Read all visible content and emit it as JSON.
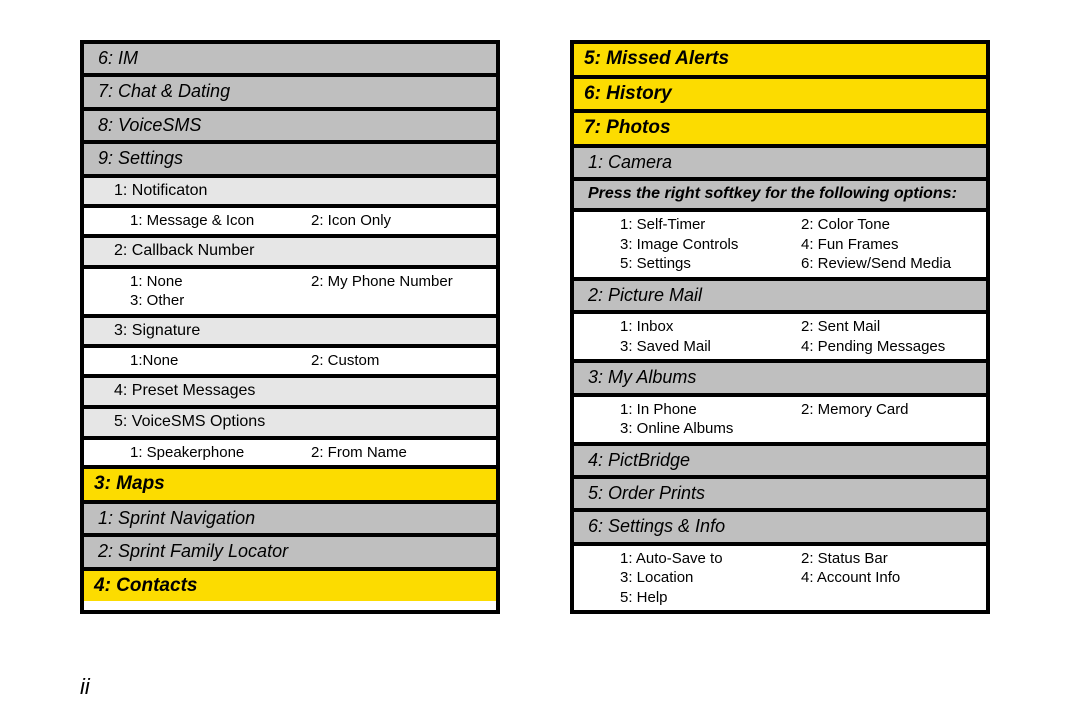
{
  "page_number": "ii",
  "left": {
    "items": [
      {
        "cls": "gray",
        "text": "6: IM"
      },
      {
        "cls": "gray",
        "text": "7: Chat & Dating"
      },
      {
        "cls": "gray",
        "text": "8: VoiceSMS"
      },
      {
        "cls": "gray",
        "text": "9: Settings"
      },
      {
        "cls": "light",
        "text": "1: Notificaton"
      },
      {
        "cls": "white",
        "pair": [
          "1: Message & Icon",
          "2: Icon Only"
        ]
      },
      {
        "cls": "light",
        "text": "2: Callback Number"
      },
      {
        "cls": "white",
        "pair": [
          "1: None",
          "2: My Phone Number"
        ],
        "extra": [
          "3: Other"
        ]
      },
      {
        "cls": "light",
        "text": "3: Signature"
      },
      {
        "cls": "white",
        "pair": [
          "1:None",
          "2: Custom"
        ]
      },
      {
        "cls": "light",
        "text": "4: Preset Messages"
      },
      {
        "cls": "light",
        "text": "5: VoiceSMS Options"
      },
      {
        "cls": "white",
        "pair": [
          "1: Speakerphone",
          "2: From Name"
        ]
      },
      {
        "cls": "yellow",
        "text": "3: Maps"
      },
      {
        "cls": "gray",
        "text": "1: Sprint Navigation"
      },
      {
        "cls": "gray",
        "text": "2: Sprint Family Locator"
      },
      {
        "cls": "yellow",
        "text": "4: Contacts"
      }
    ]
  },
  "right": {
    "items": [
      {
        "cls": "yellow",
        "text": "5: Missed Alerts"
      },
      {
        "cls": "yellow",
        "text": "6: History"
      },
      {
        "cls": "yellow",
        "text": "7: Photos"
      },
      {
        "cls": "gray",
        "text": "1: Camera"
      },
      {
        "cls": "note",
        "text": "Press the right softkey for the following options:"
      },
      {
        "cls": "white",
        "pair": [
          "1: Self-Timer",
          "2: Color Tone"
        ],
        "extra_pairs": [
          [
            "3: Image Controls",
            "4: Fun Frames"
          ],
          [
            "5: Settings",
            "6: Review/Send Media"
          ]
        ]
      },
      {
        "cls": "gray",
        "text": "2: Picture Mail"
      },
      {
        "cls": "white",
        "pair": [
          "1: Inbox",
          "2: Sent Mail"
        ],
        "extra_pairs": [
          [
            "3: Saved Mail",
            "4: Pending Messages"
          ]
        ]
      },
      {
        "cls": "gray",
        "text": "3: My Albums"
      },
      {
        "cls": "white",
        "pair": [
          "1: In Phone",
          "2: Memory Card"
        ],
        "extra": [
          "3: Online Albums"
        ]
      },
      {
        "cls": "gray",
        "text": "4: PictBridge"
      },
      {
        "cls": "gray",
        "text": "5: Order Prints"
      },
      {
        "cls": "gray",
        "text": "6: Settings & Info"
      },
      {
        "cls": "white",
        "pair": [
          "1: Auto-Save to",
          "2: Status Bar"
        ],
        "extra_pairs": [
          [
            "3: Location",
            "4: Account Info"
          ]
        ],
        "extra": [
          "5: Help"
        ]
      }
    ]
  }
}
